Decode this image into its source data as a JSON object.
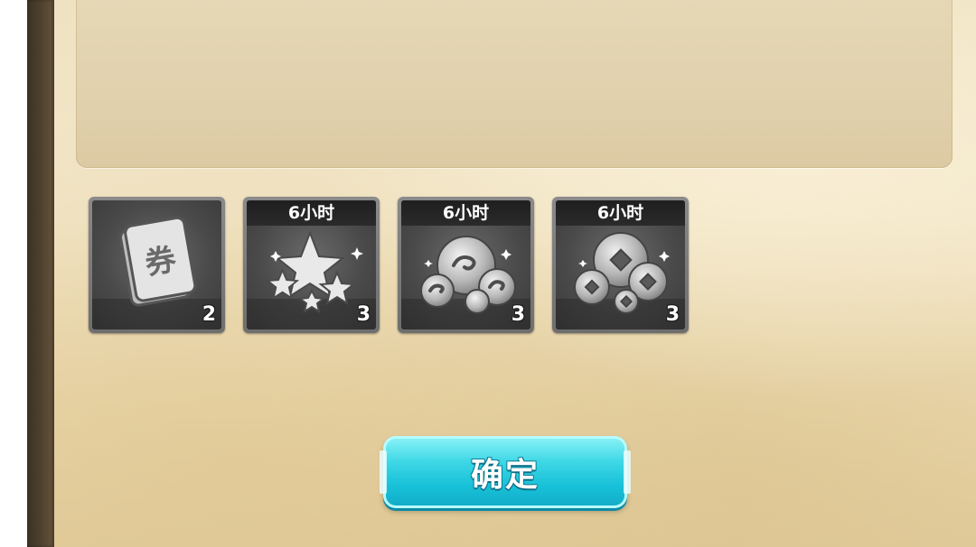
{
  "items": [
    {
      "icon": "voucher-ticket-icon",
      "duration": "",
      "count": "2"
    },
    {
      "icon": "stars-icon",
      "duration": "6小时",
      "count": "3"
    },
    {
      "icon": "cloud-orbs-icon",
      "duration": "6小时",
      "count": "3"
    },
    {
      "icon": "coins-icon",
      "duration": "6小时",
      "count": "3"
    }
  ],
  "confirm_button": {
    "label": "确定"
  },
  "colors": {
    "parchment": "#efe2c2",
    "button_accent": "#17c0d8",
    "item_frame": "#7a7a7a"
  }
}
